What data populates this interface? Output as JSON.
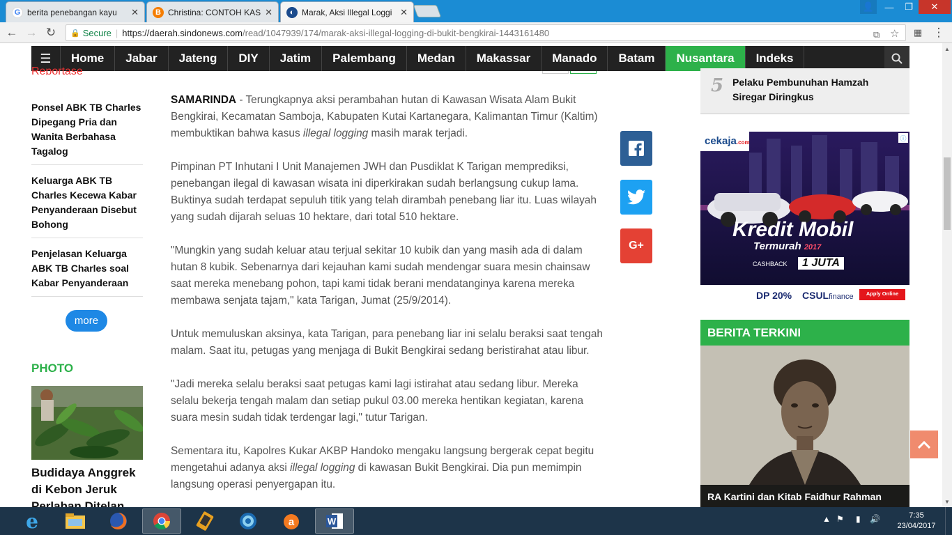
{
  "browser": {
    "tabs": [
      {
        "title": "berita penebangan kayu",
        "favicon": "google-icon",
        "active": false
      },
      {
        "title": "Christina: CONTOH KASU",
        "favicon": "blogger-icon",
        "active": false
      },
      {
        "title": "Marak, Aksi Illegal Loggi",
        "favicon": "sindonews-icon",
        "active": true
      }
    ],
    "secure_label": "Secure",
    "url_host": "https://daerah.sindonews.com",
    "url_path": "/read/1047939/174/marak-aksi-illegal-logging-di-bukit-bengkirai-1443161480"
  },
  "site_nav": {
    "items": [
      "Home",
      "Jabar",
      "Jateng",
      "DIY",
      "Jatim",
      "Palembang",
      "Medan",
      "Makassar",
      "Manado",
      "Batam",
      "Nusantara",
      "Indeks"
    ],
    "active": "Nusantara"
  },
  "left": {
    "section_title": "Reportase",
    "related": [
      "Ponsel ABK TB Charles Dipegang Pria dan Wanita Berbahasa Tagalog",
      "Keluarga ABK TB Charles Kecewa Kabar Penyanderaan Disebut Bohong",
      "Penjelasan Keluarga ABK TB Charles soal Kabar Penyanderaan"
    ],
    "more_label": "more",
    "photo_title": "PHOTO",
    "photo_caption": "Budidaya Anggrek di Kebon Jeruk Perlahan Ditelan"
  },
  "article": {
    "dateline": "SAMARINDA",
    "p1_rest": " - Terungkapnya aksi perambahan hutan di Kawasan Wisata Alam Bukit Bengkirai, Kecamatan Samboja, Kabupaten Kutai Kartanegara, Kalimantan Timur (Kaltim) membuktikan bahwa kasus ",
    "p1_em": "illegal logging",
    "p1_end": " masih marak terjadi.",
    "p2": "Pimpinan PT Inhutani I Unit Manajemen JWH dan Pusdiklat K Tarigan memprediksi, penebangan ilegal di kawasan wisata ini diperkirakan sudah berlangsung cukup lama. Buktinya sudah terdapat sepuluh titik yang telah dirambah penebang liar itu. Luas wilayah yang sudah dijarah seluas 10 hektare, dari total 510 hektare.",
    "p3": "\"Mungkin yang sudah keluar atau terjual sekitar 10 kubik dan yang masih ada di dalam hutan 8 kubik. Sebenarnya dari kejauhan kami sudah mendengar suara mesin chainsaw saat mereka menebang pohon, tapi kami tidak berani mendatanginya karena mereka membawa senjata tajam,\" kata Tarigan, Jumat (25/9/2014).",
    "p4": "Untuk memuluskan aksinya, kata Tarigan, para penebang liar ini selalu beraksi saat tengah malam. Saat itu, petugas yang menjaga di Bukit Bengkirai sedang beristirahat atau libur.",
    "p5": "\"Jadi mereka selalu beraksi saat petugas kami lagi istirahat atau sedang libur. Mereka selalu bekerja tengah malam dan setiap pukul 03.00 mereka hentikan kegiatan, karena suara mesin sudah tidak terdengar lagi,\" tutur Tarigan.",
    "p6_start": "Sementara itu, Kapolres Kukar AKBP Handoko mengaku langsung bergerak cepat begitu mengetahui adanya aksi ",
    "p6_em": "illegal logging",
    "p6_end": " di kawasan Bukit Bengkirai. Dia pun memimpin langsung operasi penyergapan itu."
  },
  "social": {
    "facebook": "f",
    "twitter": "t",
    "gplus": "G+"
  },
  "right": {
    "popular_num": "5",
    "popular_title": "Pelaku Pembunuhan Hamzah Siregar Diringkus",
    "ad": {
      "brand": "cekaja",
      "brand_suffix": ".com",
      "headline": "Kredit Mobil",
      "sub": "Termurah",
      "year": "2017",
      "cashback_label": "CASHBACK",
      "cashback_value": "1 JUTA",
      "dp": "DP 20%",
      "partner": "CSUL",
      "partner_suffix": "finance",
      "apply": "Apply Online"
    },
    "terkini_title": "BERITA TERKINI",
    "terkini_caption": "RA Kartini dan Kitab Faidhur Rahman"
  },
  "taskbar": {
    "time": "7:35",
    "date": "23/04/2017",
    "apps": [
      "ie-icon",
      "explorer-icon",
      "firefox-icon",
      "chrome-icon",
      "app-icon",
      "app2-icon",
      "avast-icon",
      "word-icon"
    ]
  },
  "colors": {
    "nav_active": "#2db14a",
    "nav_bg": "#222222",
    "more": "#1e88e5",
    "facebook": "#2d5f95",
    "twitter": "#1da1f2",
    "gplus": "#e44134"
  }
}
